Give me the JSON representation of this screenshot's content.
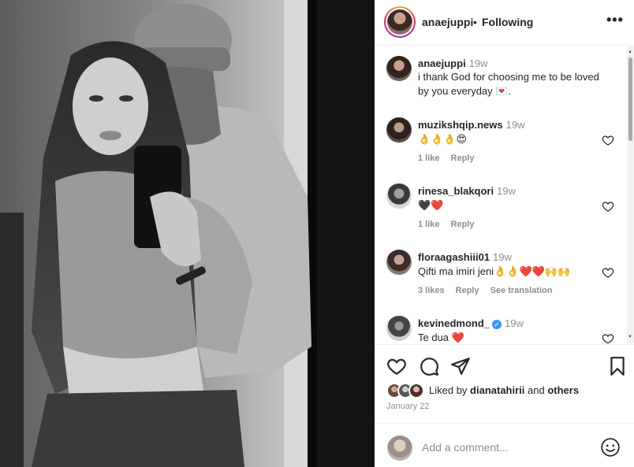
{
  "post": {
    "author": "anaejuppi",
    "follow_status": "Following",
    "separator": "•",
    "more_label": "•••"
  },
  "caption": {
    "user": "anaejuppi",
    "time": "19w",
    "text": "i thank God for choosing me to be loved by you everyday 💌."
  },
  "comments": [
    {
      "user": "muzikshqip.news",
      "time": "19w",
      "text": "👌👌👌😍",
      "likes": "1 like",
      "reply": "Reply",
      "translate": "",
      "verified": false
    },
    {
      "user": "rinesa_blakqori",
      "time": "19w",
      "text": "🖤❤️",
      "likes": "1 like",
      "reply": "Reply",
      "translate": "",
      "verified": false
    },
    {
      "user": "floraagashiii01",
      "time": "19w",
      "text": "Qifti ma imiri jeni👌👌❤️❤️🙌🙌",
      "likes": "3 likes",
      "reply": "Reply",
      "translate": "See translation",
      "verified": false
    },
    {
      "user": "kevinedmond_",
      "time": "19w",
      "text": "Te dua ❤️",
      "likes": "",
      "reply": "",
      "translate": "",
      "verified": true
    }
  ],
  "actions": {
    "like_icon": "heart-icon",
    "comment_icon": "comment-icon",
    "share_icon": "send-icon",
    "save_icon": "bookmark-icon"
  },
  "likes": {
    "prefix": "Liked by ",
    "user": "dianatahirii",
    "and": " and ",
    "others": "others"
  },
  "date": "January 22",
  "add_comment": {
    "placeholder": "Add a comment...",
    "emoji_icon": "smiley-icon"
  },
  "colors": {
    "text": "#262626",
    "muted": "#8e8e8e",
    "verified": "#3897f0",
    "heart": "#c0152f"
  }
}
